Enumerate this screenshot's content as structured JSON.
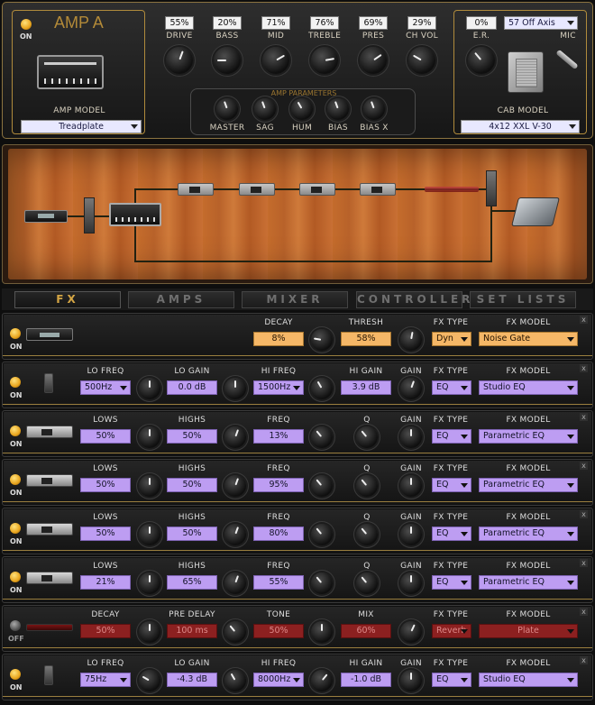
{
  "amp": {
    "title": "AMP A",
    "on_label": "ON",
    "amp_model_label": "AMP MODEL",
    "amp_model": "Treadplate",
    "knobs": [
      {
        "label": "DRIVE",
        "value": "55%"
      },
      {
        "label": "BASS",
        "value": "20%"
      },
      {
        "label": "MID",
        "value": "71%"
      },
      {
        "label": "TREBLE",
        "value": "76%"
      },
      {
        "label": "PRES",
        "value": "69%"
      },
      {
        "label": "CH VOL",
        "value": "29%"
      }
    ],
    "params_title": "AMP PARAMETERS",
    "params": [
      "MASTER",
      "SAG",
      "HUM",
      "BIAS",
      "BIAS X"
    ],
    "er_label": "E.R.",
    "er_value": "0%",
    "mic_label": "MIC",
    "mic_value": "57 Off Axis",
    "cab_model_label": "CAB MODEL",
    "cab_model": "4x12 XXL V-30"
  },
  "tabs": [
    "FX",
    "AMPS",
    "MIXER",
    "CONTROLLERS",
    "SET LISTS"
  ],
  "fx_rows": [
    {
      "on": "ON",
      "type_label": "FX TYPE",
      "type": "Dyn",
      "model_label": "FX MODEL",
      "model": "Noise Gate",
      "params": [
        {
          "label": "DECAY",
          "value": "8%"
        },
        {
          "label": "THRESH",
          "value": "58%"
        }
      ]
    },
    {
      "on": "ON",
      "type_label": "FX TYPE",
      "type": "EQ",
      "model_label": "FX MODEL",
      "model": "Studio EQ",
      "params": [
        {
          "label": "LO FREQ",
          "value": "500Hz"
        },
        {
          "label": "LO GAIN",
          "value": "0.0 dB"
        },
        {
          "label": "HI FREQ",
          "value": "1500Hz"
        },
        {
          "label": "HI GAIN",
          "value": "3.9 dB"
        },
        {
          "label": "GAIN",
          "value": ""
        }
      ]
    },
    {
      "on": "ON",
      "type_label": "FX TYPE",
      "type": "EQ",
      "model_label": "FX MODEL",
      "model": "Parametric EQ",
      "params": [
        {
          "label": "LOWS",
          "value": "50%"
        },
        {
          "label": "HIGHS",
          "value": "50%"
        },
        {
          "label": "FREQ",
          "value": "13%"
        },
        {
          "label": "Q",
          "value": ""
        },
        {
          "label": "GAIN",
          "value": ""
        }
      ]
    },
    {
      "on": "ON",
      "type_label": "FX TYPE",
      "type": "EQ",
      "model_label": "FX MODEL",
      "model": "Parametric EQ",
      "params": [
        {
          "label": "LOWS",
          "value": "50%"
        },
        {
          "label": "HIGHS",
          "value": "50%"
        },
        {
          "label": "FREQ",
          "value": "95%"
        },
        {
          "label": "Q",
          "value": ""
        },
        {
          "label": "GAIN",
          "value": ""
        }
      ]
    },
    {
      "on": "ON",
      "type_label": "FX TYPE",
      "type": "EQ",
      "model_label": "FX MODEL",
      "model": "Parametric EQ",
      "params": [
        {
          "label": "LOWS",
          "value": "50%"
        },
        {
          "label": "HIGHS",
          "value": "50%"
        },
        {
          "label": "FREQ",
          "value": "80%"
        },
        {
          "label": "Q",
          "value": ""
        },
        {
          "label": "GAIN",
          "value": ""
        }
      ]
    },
    {
      "on": "ON",
      "type_label": "FX TYPE",
      "type": "EQ",
      "model_label": "FX MODEL",
      "model": "Parametric EQ",
      "params": [
        {
          "label": "LOWS",
          "value": "21%"
        },
        {
          "label": "HIGHS",
          "value": "65%"
        },
        {
          "label": "FREQ",
          "value": "55%"
        },
        {
          "label": "Q",
          "value": ""
        },
        {
          "label": "GAIN",
          "value": ""
        }
      ]
    },
    {
      "on": "OFF",
      "type_label": "FX TYPE",
      "type": "Reverb",
      "model_label": "FX MODEL",
      "model": "Plate",
      "params": [
        {
          "label": "DECAY",
          "value": "50%"
        },
        {
          "label": "PRE DELAY",
          "value": "100 ms"
        },
        {
          "label": "TONE",
          "value": "50%"
        },
        {
          "label": "MIX",
          "value": "60%"
        }
      ]
    },
    {
      "on": "ON",
      "type_label": "FX TYPE",
      "type": "EQ",
      "model_label": "FX MODEL",
      "model": "Studio EQ",
      "params": [
        {
          "label": "LO FREQ",
          "value": "75Hz"
        },
        {
          "label": "LO GAIN",
          "value": "-4.3 dB"
        },
        {
          "label": "HI FREQ",
          "value": "8000Hz"
        },
        {
          "label": "HI GAIN",
          "value": "-1.0 dB"
        },
        {
          "label": "GAIN",
          "value": ""
        }
      ]
    }
  ],
  "close_glyph": "x"
}
